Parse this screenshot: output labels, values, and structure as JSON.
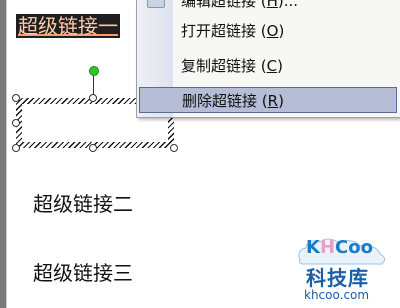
{
  "context_menu": {
    "items": [
      {
        "label": "编辑超链接 (",
        "accel": "H",
        "suffix": ")..."
      },
      {
        "label": "打开超链接 (",
        "accel": "O",
        "suffix": ")"
      },
      {
        "label": "复制超链接 (",
        "accel": "C",
        "suffix": ")"
      },
      {
        "label": "删除超链接 (",
        "accel": "R",
        "suffix": ")"
      }
    ],
    "highlighted_index": 3
  },
  "document": {
    "selected_link": "超级链接一",
    "link2": "超级链接二",
    "link3": "超级链接三"
  },
  "watermark": {
    "logo_k": "K",
    "logo_h": "H",
    "logo_rest": "Coo",
    "cn": "科技库",
    "url": "khcoo.com"
  },
  "colors": {
    "menu_highlight": "#b5bed6",
    "rotate_handle": "#2ec52e",
    "logo_blue": "#1a7cc6"
  }
}
